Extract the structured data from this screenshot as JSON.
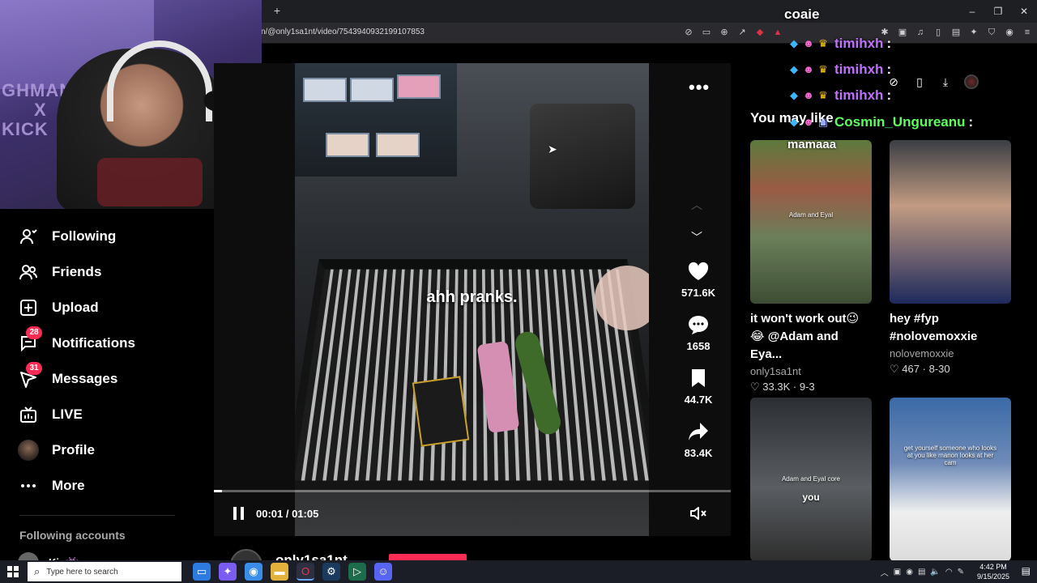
{
  "browser": {
    "url": "n/@only1sa1nt/video/7543940932199107853",
    "new_tab_label": "+",
    "window_controls": [
      "–",
      "❐",
      "✕"
    ]
  },
  "webcam": {
    "wall_text_line1": "GHMAN",
    "wall_text_line2": "X",
    "wall_text_line3": "KICK"
  },
  "sidebar": {
    "items": [
      {
        "label": "Following",
        "icon": "following-icon"
      },
      {
        "label": "Friends",
        "icon": "friends-icon"
      },
      {
        "label": "Upload",
        "icon": "upload-icon"
      },
      {
        "label": "Notifications",
        "icon": "notifications-icon",
        "badge": "28"
      },
      {
        "label": "Messages",
        "icon": "messages-icon",
        "badge": "31"
      },
      {
        "label": "LIVE",
        "icon": "live-icon"
      },
      {
        "label": "Profile",
        "icon": "profile-avatar"
      },
      {
        "label": "More",
        "icon": "more-icon"
      }
    ],
    "following_accounts_heading": "Following accounts",
    "following_first": "Kin👾"
  },
  "video": {
    "caption": "ahh pranks.",
    "time": "00:01 / 01:05",
    "progress": 0.015,
    "author": "only1sa1nt"
  },
  "actions": {
    "likes": "571.6K",
    "comments": "1658",
    "saves": "44.7K",
    "shares": "83.4K"
  },
  "right": {
    "heading": "You may like",
    "cards": [
      {
        "desc_line1": "it won't work out😉",
        "desc_line2": "😂 @Adam and Eya...",
        "author": "only1sa1nt",
        "likes": "33.3K",
        "date": "9-3",
        "overlay": "Adam and Eyal"
      },
      {
        "desc_line1": "hey #fyp",
        "desc_line2": "#nolovemoxxie",
        "author": "nolovemoxxie",
        "likes": "467",
        "date": "8-30",
        "overlay": ""
      },
      {
        "overlay": "Adam and Eyal core",
        "overlay2": "you"
      },
      {
        "overlay": "get yourself someone who looks at you like manon looks at her cam"
      }
    ]
  },
  "chat": {
    "header": "coaie",
    "lines": [
      {
        "name": "timihxh",
        "sep": ":",
        "color": "#c070ff"
      },
      {
        "name": "timihxh",
        "sep": ":",
        "color": "#c070ff"
      },
      {
        "name": "timihxh",
        "sep": ":",
        "color": "#c070ff"
      },
      {
        "name": "Cosmin_Ungureanu",
        "sep": ":",
        "color": "#5cff5c"
      }
    ],
    "last_message": "mamaaa"
  },
  "taskbar": {
    "search_placeholder": "Type here to search",
    "time": "4:42 PM",
    "date": "9/15/2025"
  },
  "colors": {
    "accent": "#fe2c55",
    "chat_purple": "#c070ff",
    "chat_green": "#5cff5c"
  }
}
